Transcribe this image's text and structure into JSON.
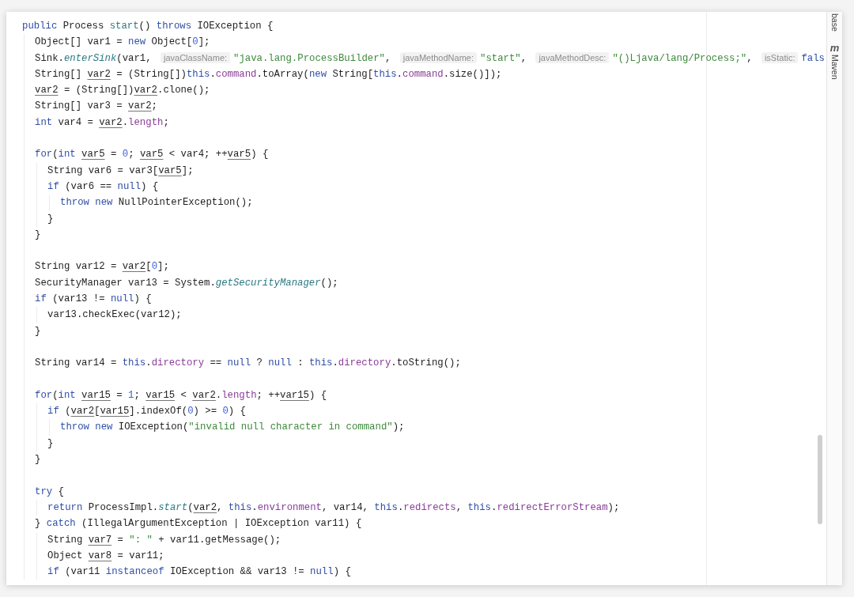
{
  "code": [
    {
      "tokens": [
        {
          "kind": "kw",
          "text": "public"
        },
        {
          "kind": "plain",
          "text": " Process "
        },
        {
          "kind": "decl",
          "text": "start"
        },
        {
          "kind": "plain",
          "text": "() "
        },
        {
          "kind": "kw",
          "text": "throws"
        },
        {
          "kind": "plain",
          "text": " IOException {"
        }
      ],
      "children": [
        {
          "tokens": [
            {
              "kind": "plain",
              "text": "Object[] var1 = "
            },
            {
              "kind": "kw",
              "text": "new"
            },
            {
              "kind": "plain",
              "text": " Object["
            },
            {
              "kind": "num",
              "text": "0"
            },
            {
              "kind": "plain",
              "text": "];"
            }
          ]
        },
        {
          "tokens": [
            {
              "kind": "plain",
              "text": "Sink."
            },
            {
              "kind": "static",
              "text": "enterSink"
            },
            {
              "kind": "plain",
              "text": "(var1, "
            },
            {
              "kind": "hint",
              "text": "javaClassName:"
            },
            {
              "kind": "str",
              "text": "\"java.lang.ProcessBuilder\""
            },
            {
              "kind": "plain",
              "text": ", "
            },
            {
              "kind": "hint",
              "text": "javaMethodName:"
            },
            {
              "kind": "str",
              "text": "\"start\""
            },
            {
              "kind": "plain",
              "text": ", "
            },
            {
              "kind": "hint",
              "text": "javaMethodDesc:"
            },
            {
              "kind": "str",
              "text": "\"()Ljava/lang/Process;\""
            },
            {
              "kind": "plain",
              "text": ", "
            },
            {
              "kind": "hint",
              "text": "isStatic:"
            },
            {
              "kind": "kw",
              "text": "fals"
            }
          ]
        },
        {
          "tokens": [
            {
              "kind": "plain",
              "text": "String[] "
            },
            {
              "kind": "var",
              "text": "var2"
            },
            {
              "kind": "plain",
              "text": " = (String[])"
            },
            {
              "kind": "kw",
              "text": "this"
            },
            {
              "kind": "plain",
              "text": "."
            },
            {
              "kind": "field",
              "text": "command"
            },
            {
              "kind": "plain",
              "text": ".toArray("
            },
            {
              "kind": "kw",
              "text": "new"
            },
            {
              "kind": "plain",
              "text": " String["
            },
            {
              "kind": "kw",
              "text": "this"
            },
            {
              "kind": "plain",
              "text": "."
            },
            {
              "kind": "field",
              "text": "command"
            },
            {
              "kind": "plain",
              "text": ".size()]);"
            }
          ]
        },
        {
          "tokens": [
            {
              "kind": "var",
              "text": "var2"
            },
            {
              "kind": "plain",
              "text": " = (String[])"
            },
            {
              "kind": "var",
              "text": "var2"
            },
            {
              "kind": "plain",
              "text": ".clone();"
            }
          ]
        },
        {
          "tokens": [
            {
              "kind": "plain",
              "text": "String[] var3 = "
            },
            {
              "kind": "var",
              "text": "var2"
            },
            {
              "kind": "plain",
              "text": ";"
            }
          ]
        },
        {
          "tokens": [
            {
              "kind": "kw",
              "text": "int"
            },
            {
              "kind": "plain",
              "text": " var4 = "
            },
            {
              "kind": "var",
              "text": "var2"
            },
            {
              "kind": "plain",
              "text": "."
            },
            {
              "kind": "field",
              "text": "length"
            },
            {
              "kind": "plain",
              "text": ";"
            }
          ]
        },
        {
          "space_before": true,
          "tokens": [
            {
              "kind": "kw",
              "text": "for"
            },
            {
              "kind": "plain",
              "text": "("
            },
            {
              "kind": "kw",
              "text": "int "
            },
            {
              "kind": "var",
              "text": "var5"
            },
            {
              "kind": "plain",
              "text": " = "
            },
            {
              "kind": "num",
              "text": "0"
            },
            {
              "kind": "plain",
              "text": "; "
            },
            {
              "kind": "var",
              "text": "var5"
            },
            {
              "kind": "plain",
              "text": " < var4; ++"
            },
            {
              "kind": "var",
              "text": "var5"
            },
            {
              "kind": "plain",
              "text": ") {"
            }
          ],
          "children": [
            {
              "tokens": [
                {
                  "kind": "plain",
                  "text": "String var6 = var3["
                },
                {
                  "kind": "var",
                  "text": "var5"
                },
                {
                  "kind": "plain",
                  "text": "];"
                }
              ]
            },
            {
              "tokens": [
                {
                  "kind": "kw",
                  "text": "if"
                },
                {
                  "kind": "plain",
                  "text": " (var6 == "
                },
                {
                  "kind": "kw",
                  "text": "null"
                },
                {
                  "kind": "plain",
                  "text": ") {"
                }
              ],
              "children": [
                {
                  "tokens": [
                    {
                      "kind": "kw",
                      "text": "throw "
                    },
                    {
                      "kind": "kw",
                      "text": "new"
                    },
                    {
                      "kind": "plain",
                      "text": " NullPointerException();"
                    }
                  ]
                }
              ]
            },
            {
              "tokens": [
                {
                  "kind": "plain",
                  "text": "}"
                }
              ]
            }
          ]
        },
        {
          "tokens": [
            {
              "kind": "plain",
              "text": "}"
            }
          ]
        },
        {
          "space_before": true,
          "tokens": [
            {
              "kind": "plain",
              "text": "String var12 = "
            },
            {
              "kind": "var",
              "text": "var2"
            },
            {
              "kind": "plain",
              "text": "["
            },
            {
              "kind": "num",
              "text": "0"
            },
            {
              "kind": "plain",
              "text": "];"
            }
          ]
        },
        {
          "tokens": [
            {
              "kind": "plain",
              "text": "SecurityManager var13 = System."
            },
            {
              "kind": "static",
              "text": "getSecurityManager"
            },
            {
              "kind": "plain",
              "text": "();"
            }
          ]
        },
        {
          "tokens": [
            {
              "kind": "kw",
              "text": "if"
            },
            {
              "kind": "plain",
              "text": " (var13 != "
            },
            {
              "kind": "kw",
              "text": "null"
            },
            {
              "kind": "plain",
              "text": ") {"
            }
          ],
          "children": [
            {
              "tokens": [
                {
                  "kind": "plain",
                  "text": "var13.checkExec(var12);"
                }
              ]
            }
          ]
        },
        {
          "tokens": [
            {
              "kind": "plain",
              "text": "}"
            }
          ]
        },
        {
          "space_before": true,
          "tokens": [
            {
              "kind": "plain",
              "text": "String var14 = "
            },
            {
              "kind": "kw",
              "text": "this"
            },
            {
              "kind": "plain",
              "text": "."
            },
            {
              "kind": "field",
              "text": "directory"
            },
            {
              "kind": "plain",
              "text": " == "
            },
            {
              "kind": "kw",
              "text": "null"
            },
            {
              "kind": "plain",
              "text": " ? "
            },
            {
              "kind": "kw",
              "text": "null"
            },
            {
              "kind": "plain",
              "text": " : "
            },
            {
              "kind": "kw",
              "text": "this"
            },
            {
              "kind": "plain",
              "text": "."
            },
            {
              "kind": "field",
              "text": "directory"
            },
            {
              "kind": "plain",
              "text": ".toString();"
            }
          ]
        },
        {
          "space_before": true,
          "tokens": [
            {
              "kind": "kw",
              "text": "for"
            },
            {
              "kind": "plain",
              "text": "("
            },
            {
              "kind": "kw",
              "text": "int "
            },
            {
              "kind": "var",
              "text": "var15"
            },
            {
              "kind": "plain",
              "text": " = "
            },
            {
              "kind": "num",
              "text": "1"
            },
            {
              "kind": "plain",
              "text": "; "
            },
            {
              "kind": "var",
              "text": "var15"
            },
            {
              "kind": "plain",
              "text": " < "
            },
            {
              "kind": "var",
              "text": "var2"
            },
            {
              "kind": "plain",
              "text": "."
            },
            {
              "kind": "field",
              "text": "length"
            },
            {
              "kind": "plain",
              "text": "; ++"
            },
            {
              "kind": "var",
              "text": "var15"
            },
            {
              "kind": "plain",
              "text": ") {"
            }
          ],
          "children": [
            {
              "tokens": [
                {
                  "kind": "kw",
                  "text": "if"
                },
                {
                  "kind": "plain",
                  "text": " ("
                },
                {
                  "kind": "var",
                  "text": "var2"
                },
                {
                  "kind": "plain",
                  "text": "["
                },
                {
                  "kind": "var",
                  "text": "var15"
                },
                {
                  "kind": "plain",
                  "text": "].indexOf("
                },
                {
                  "kind": "num",
                  "text": "0"
                },
                {
                  "kind": "plain",
                  "text": ") >= "
                },
                {
                  "kind": "num",
                  "text": "0"
                },
                {
                  "kind": "plain",
                  "text": ") {"
                }
              ],
              "children": [
                {
                  "tokens": [
                    {
                      "kind": "kw",
                      "text": "throw "
                    },
                    {
                      "kind": "kw",
                      "text": "new"
                    },
                    {
                      "kind": "plain",
                      "text": " IOException("
                    },
                    {
                      "kind": "str",
                      "text": "\"invalid null character in command\""
                    },
                    {
                      "kind": "plain",
                      "text": ");"
                    }
                  ]
                }
              ]
            },
            {
              "tokens": [
                {
                  "kind": "plain",
                  "text": "}"
                }
              ]
            }
          ]
        },
        {
          "tokens": [
            {
              "kind": "plain",
              "text": "}"
            }
          ]
        },
        {
          "space_before": true,
          "tokens": [
            {
              "kind": "kw",
              "text": "try"
            },
            {
              "kind": "plain",
              "text": " {"
            }
          ],
          "children": [
            {
              "tokens": [
                {
                  "kind": "kw",
                  "text": "return"
                },
                {
                  "kind": "plain",
                  "text": " ProcessImpl."
                },
                {
                  "kind": "static",
                  "text": "start"
                },
                {
                  "kind": "plain",
                  "text": "("
                },
                {
                  "kind": "var",
                  "text": "var2"
                },
                {
                  "kind": "plain",
                  "text": ", "
                },
                {
                  "kind": "kw",
                  "text": "this"
                },
                {
                  "kind": "plain",
                  "text": "."
                },
                {
                  "kind": "field",
                  "text": "environment"
                },
                {
                  "kind": "plain",
                  "text": ", var14, "
                },
                {
                  "kind": "kw",
                  "text": "this"
                },
                {
                  "kind": "plain",
                  "text": "."
                },
                {
                  "kind": "field",
                  "text": "redirects"
                },
                {
                  "kind": "plain",
                  "text": ", "
                },
                {
                  "kind": "kw",
                  "text": "this"
                },
                {
                  "kind": "plain",
                  "text": "."
                },
                {
                  "kind": "field",
                  "text": "redirectErrorStream"
                },
                {
                  "kind": "plain",
                  "text": ");"
                }
              ]
            }
          ]
        },
        {
          "tokens": [
            {
              "kind": "plain",
              "text": "} "
            },
            {
              "kind": "kw",
              "text": "catch"
            },
            {
              "kind": "plain",
              "text": " (IllegalArgumentException | IOException var11) {"
            }
          ],
          "children": [
            {
              "tokens": [
                {
                  "kind": "plain",
                  "text": "String "
                },
                {
                  "kind": "var",
                  "text": "var7"
                },
                {
                  "kind": "plain",
                  "text": " = "
                },
                {
                  "kind": "str",
                  "text": "\": \""
                },
                {
                  "kind": "plain",
                  "text": " + var11.getMessage();"
                }
              ]
            },
            {
              "tokens": [
                {
                  "kind": "plain",
                  "text": "Object "
                },
                {
                  "kind": "var",
                  "text": "var8"
                },
                {
                  "kind": "plain",
                  "text": " = var11;"
                }
              ]
            },
            {
              "tokens": [
                {
                  "kind": "kw",
                  "text": "if"
                },
                {
                  "kind": "plain",
                  "text": " (var11 "
                },
                {
                  "kind": "kw",
                  "text": "instanceof"
                },
                {
                  "kind": "plain",
                  "text": " IOException && var13 != "
                },
                {
                  "kind": "kw",
                  "text": "null"
                },
                {
                  "kind": "plain",
                  "text": ") {"
                }
              ]
            }
          ]
        }
      ]
    }
  ],
  "tool_windows": [
    {
      "label": "base"
    },
    {
      "glyph": "m",
      "label": "Maven"
    }
  ]
}
